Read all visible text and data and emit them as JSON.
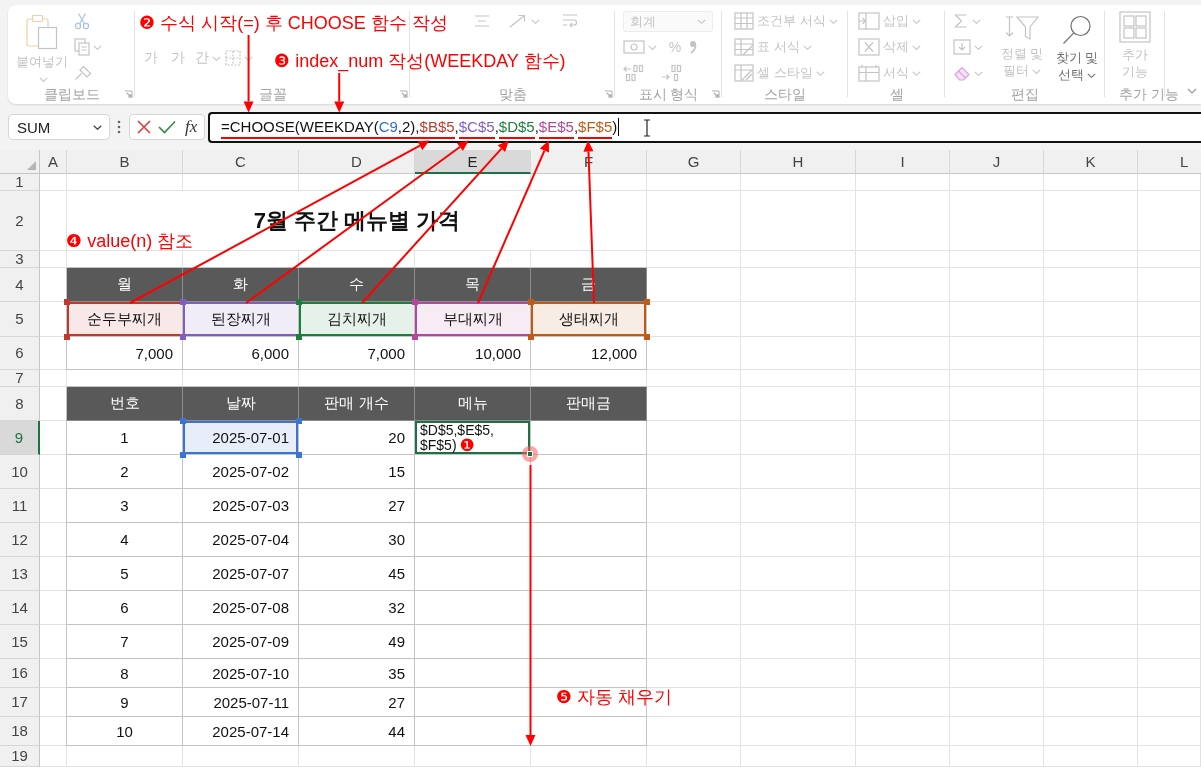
{
  "ribbon": {
    "groups": [
      {
        "label": "클립보드",
        "launcher": true,
        "items": [
          {
            "kind": "big",
            "label": "붙여넣기",
            "caret": true,
            "disabled": true
          },
          {
            "kind": "small",
            "caret": false,
            "disabled": true
          },
          {
            "kind": "small",
            "caret": true,
            "disabled": true
          },
          {
            "kind": "small",
            "caret": false,
            "disabled": true
          }
        ]
      },
      {
        "label": "글꼴",
        "launcher": true,
        "items": [
          {
            "kind": "glyph",
            "label": "가",
            "caret": false,
            "disabled": true
          },
          {
            "kind": "glyph",
            "label": "가",
            "caret": false,
            "disabled": true
          },
          {
            "kind": "glyph",
            "label": "간",
            "caret": true,
            "disabled": true
          },
          {
            "kind": "small",
            "caret": true,
            "disabled": true
          }
        ]
      },
      {
        "label": "맞춤",
        "launcher": true,
        "items": [
          {
            "kind": "small",
            "caret": false,
            "disabled": true
          },
          {
            "kind": "small",
            "caret": true,
            "disabled": true
          },
          {
            "kind": "small",
            "caret": false,
            "disabled": true
          }
        ]
      },
      {
        "label": "표시 형식",
        "launcher": true,
        "items": [
          {
            "kind": "dropdown",
            "label": "회계",
            "caret": true,
            "disabled": true
          },
          {
            "kind": "small",
            "caret": true,
            "disabled": true
          },
          {
            "kind": "glyph",
            "label": "%",
            "caret": false,
            "disabled": true
          },
          {
            "kind": "small",
            "caret": false,
            "disabled": true
          },
          {
            "kind": "small",
            "caret": false,
            "disabled": true
          },
          {
            "kind": "small",
            "caret": false,
            "disabled": true
          }
        ]
      },
      {
        "label": "스타일",
        "launcher": false,
        "items": [
          {
            "kind": "small",
            "label": "조건부 서식",
            "caret": true,
            "disabled": true
          },
          {
            "kind": "small",
            "label": "표 서식",
            "caret": true,
            "disabled": true
          },
          {
            "kind": "small",
            "label": "셀 스타일",
            "caret": true,
            "disabled": true
          }
        ]
      },
      {
        "label": "셀",
        "launcher": false,
        "items": [
          {
            "kind": "small",
            "label": "삽입",
            "caret": true,
            "disabled": true
          },
          {
            "kind": "small",
            "label": "삭제",
            "caret": true,
            "disabled": true
          },
          {
            "kind": "small",
            "label": "서식",
            "caret": true,
            "disabled": true
          }
        ]
      },
      {
        "label": "편집",
        "launcher": false,
        "items": [
          {
            "kind": "small",
            "caret": true,
            "disabled": true
          },
          {
            "kind": "small",
            "caret": true,
            "disabled": true
          },
          {
            "kind": "small",
            "caret": true,
            "disabled": true
          },
          {
            "kind": "big",
            "label": "정렬 및 필터",
            "caret": true,
            "disabled": true
          },
          {
            "kind": "big",
            "label": "찾기 및 선택",
            "caret": true,
            "disabled": false
          }
        ]
      },
      {
        "label": "추가 기능",
        "launcher": false,
        "items": [
          {
            "kind": "big",
            "label": "추가 기능",
            "caret": false,
            "disabled": true
          }
        ]
      }
    ]
  },
  "formula_bar": {
    "name_box": "SUM",
    "function_label": "fx",
    "segments": [
      {
        "text": "=CHOOSE(",
        "underlined": true
      },
      {
        "text": "WEEKDAY(",
        "underlined": true
      },
      {
        "text": "C9",
        "color": "#2f6fcf",
        "underlined": true
      },
      {
        "text": ",2),",
        "underlined": true
      },
      {
        "text": "$B$5",
        "color": "#c0392b",
        "underlined": true
      },
      {
        "text": ",",
        "underlined": false
      },
      {
        "text": "$C$5",
        "color": "#7e5fc1",
        "underlined": true
      },
      {
        "text": ",",
        "underlined": false
      },
      {
        "text": "$D$5",
        "color": "#1b7f3b",
        "underlined": true
      },
      {
        "text": ",",
        "underlined": false
      },
      {
        "text": "$E$5",
        "color": "#b2479b",
        "underlined": true
      },
      {
        "text": ",",
        "underlined": false
      },
      {
        "text": "$F$5",
        "color": "#c25a14",
        "underlined": true
      },
      {
        "text": ")",
        "underlined": false
      }
    ]
  },
  "sheet": {
    "columns": [
      {
        "label": "A",
        "selected": false
      },
      {
        "label": "B",
        "selected": false
      },
      {
        "label": "C",
        "selected": false
      },
      {
        "label": "D",
        "selected": false
      },
      {
        "label": "E",
        "selected": true
      },
      {
        "label": "F",
        "selected": false
      },
      {
        "label": "G",
        "selected": false
      },
      {
        "label": "H",
        "selected": false
      },
      {
        "label": "I",
        "selected": false
      },
      {
        "label": "J",
        "selected": false
      },
      {
        "label": "K",
        "selected": false
      },
      {
        "label": "L",
        "selected": false
      }
    ],
    "rows": [
      {
        "label": "1",
        "selected": false
      },
      {
        "label": "2",
        "selected": false
      },
      {
        "label": "3",
        "selected": false
      },
      {
        "label": "4",
        "selected": false
      },
      {
        "label": "5",
        "selected": false
      },
      {
        "label": "6",
        "selected": false
      },
      {
        "label": "7",
        "selected": false
      },
      {
        "label": "8",
        "selected": false
      },
      {
        "label": "9",
        "selected": true
      },
      {
        "label": "10",
        "selected": false
      },
      {
        "label": "11",
        "selected": false
      },
      {
        "label": "12",
        "selected": false
      },
      {
        "label": "13",
        "selected": false
      },
      {
        "label": "14",
        "selected": false
      },
      {
        "label": "15",
        "selected": false
      },
      {
        "label": "16",
        "selected": false
      },
      {
        "label": "17",
        "selected": false
      },
      {
        "label": "18",
        "selected": false
      },
      {
        "label": "19",
        "selected": false
      }
    ],
    "title": "7월 주간 메뉴별 가격",
    "menu_table": {
      "days": [
        "월",
        "화",
        "수",
        "목",
        "금"
      ],
      "menus": [
        {
          "name": "순두부찌개",
          "color": "#c0392b"
        },
        {
          "name": "된장찌개",
          "color": "#7e5fc1"
        },
        {
          "name": "김치찌개",
          "color": "#1b7f3b"
        },
        {
          "name": "부대찌개",
          "color": "#b2479b"
        },
        {
          "name": "생태찌개",
          "color": "#c25a14"
        }
      ],
      "prices": [
        "7,000",
        "6,000",
        "7,000",
        "10,000",
        "12,000"
      ]
    },
    "sales_table": {
      "columns": [
        "번호",
        "날짜",
        "판매 개수",
        "메뉴",
        "판매금"
      ],
      "rows": [
        {
          "number": "1",
          "date": "2025-07-01",
          "count": "20",
          "referenced": true,
          "active": true
        },
        {
          "number": "2",
          "date": "2025-07-02",
          "count": "15",
          "referenced": false,
          "active": false
        },
        {
          "number": "3",
          "date": "2025-07-03",
          "count": "27",
          "referenced": false,
          "active": false
        },
        {
          "number": "4",
          "date": "2025-07-04",
          "count": "30",
          "referenced": false,
          "active": false
        },
        {
          "number": "5",
          "date": "2025-07-07",
          "count": "45",
          "referenced": false,
          "active": false
        },
        {
          "number": "6",
          "date": "2025-07-08",
          "count": "32",
          "referenced": false,
          "active": false
        },
        {
          "number": "7",
          "date": "2025-07-09",
          "count": "49",
          "referenced": false,
          "active": false
        },
        {
          "number": "8",
          "date": "2025-07-10",
          "count": "35",
          "referenced": false,
          "active": false
        },
        {
          "number": "9",
          "date": "2025-07-11",
          "count": "27",
          "referenced": false,
          "active": false
        },
        {
          "number": "10",
          "date": "2025-07-14",
          "count": "44",
          "referenced": false,
          "active": false
        }
      ],
      "editing_lines": [
        "$D$5,$E$5,",
        "$F$5)"
      ]
    }
  },
  "annotations": [
    {
      "text": "❶"
    },
    {
      "text": "❷ 수식 시작(=) 후 CHOOSE 함수 작성"
    },
    {
      "text": "❸ index_num 작성(WEEKDAY 함수)"
    },
    {
      "text": "❹ value(n) 참조"
    },
    {
      "text": "❺ 자동 채우기"
    }
  ]
}
